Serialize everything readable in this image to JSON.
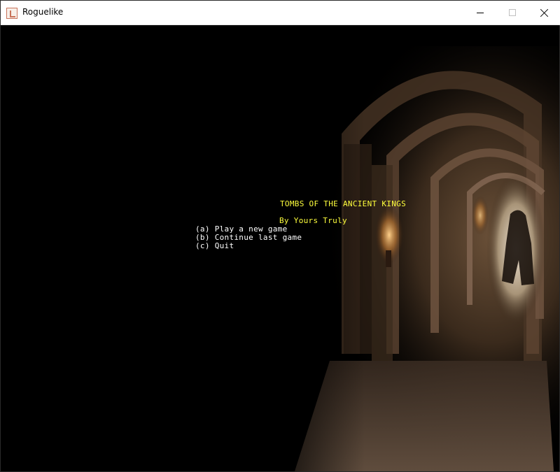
{
  "window": {
    "title": "Roguelike",
    "icon": "app-icon",
    "controls": [
      "minimize-icon",
      "maximize-icon",
      "close-icon"
    ]
  },
  "game": {
    "title": "TOMBS OF THE ANCIENT KINGS",
    "author": "By Yours Truly",
    "menu": {
      "option_a": "(a) Play a new game",
      "option_b": "(b) Continue last game",
      "option_c": "(c) Quit"
    },
    "colors": {
      "background": "#000000",
      "title": "#ffff3c",
      "menu": "#ffffff",
      "torchlight": "#e8b060",
      "stone": "#5a4030"
    }
  }
}
